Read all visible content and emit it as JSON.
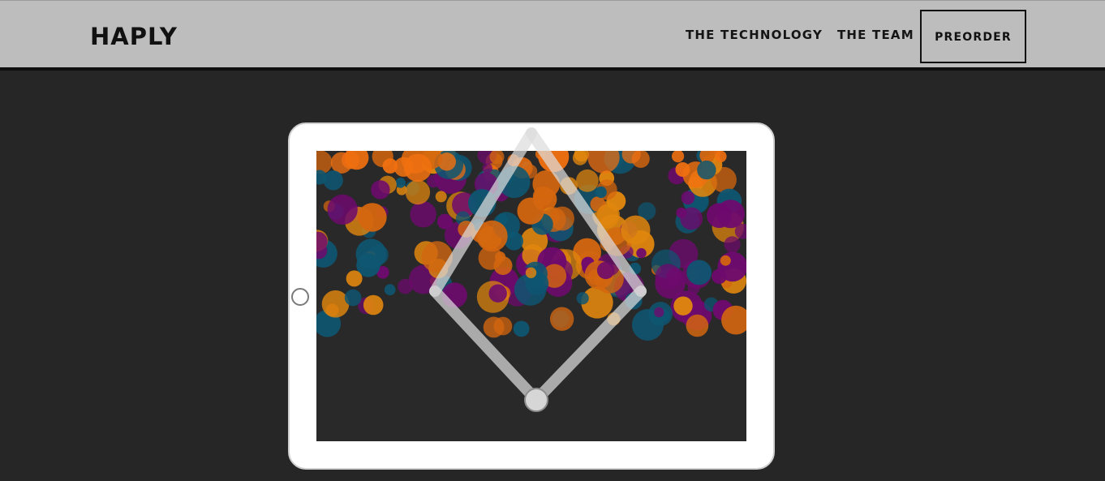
{
  "header": {
    "brand": "HAPLY",
    "nav": [
      {
        "label": "THE TECHNOLOGY"
      },
      {
        "label": "THE TEAM"
      }
    ],
    "cta_label": "PREORDER"
  },
  "colors": {
    "header_bg": "#bdbdbd",
    "page_bg": "#262626",
    "screen_bg": "#292929",
    "bubble_palette": [
      "#d4660f",
      "#e0860e",
      "#0e5672",
      "#6e0a6e",
      "#f07010"
    ]
  },
  "icons": {
    "home_button": "circle-outline-icon",
    "handle": "drag-handle-icon"
  }
}
